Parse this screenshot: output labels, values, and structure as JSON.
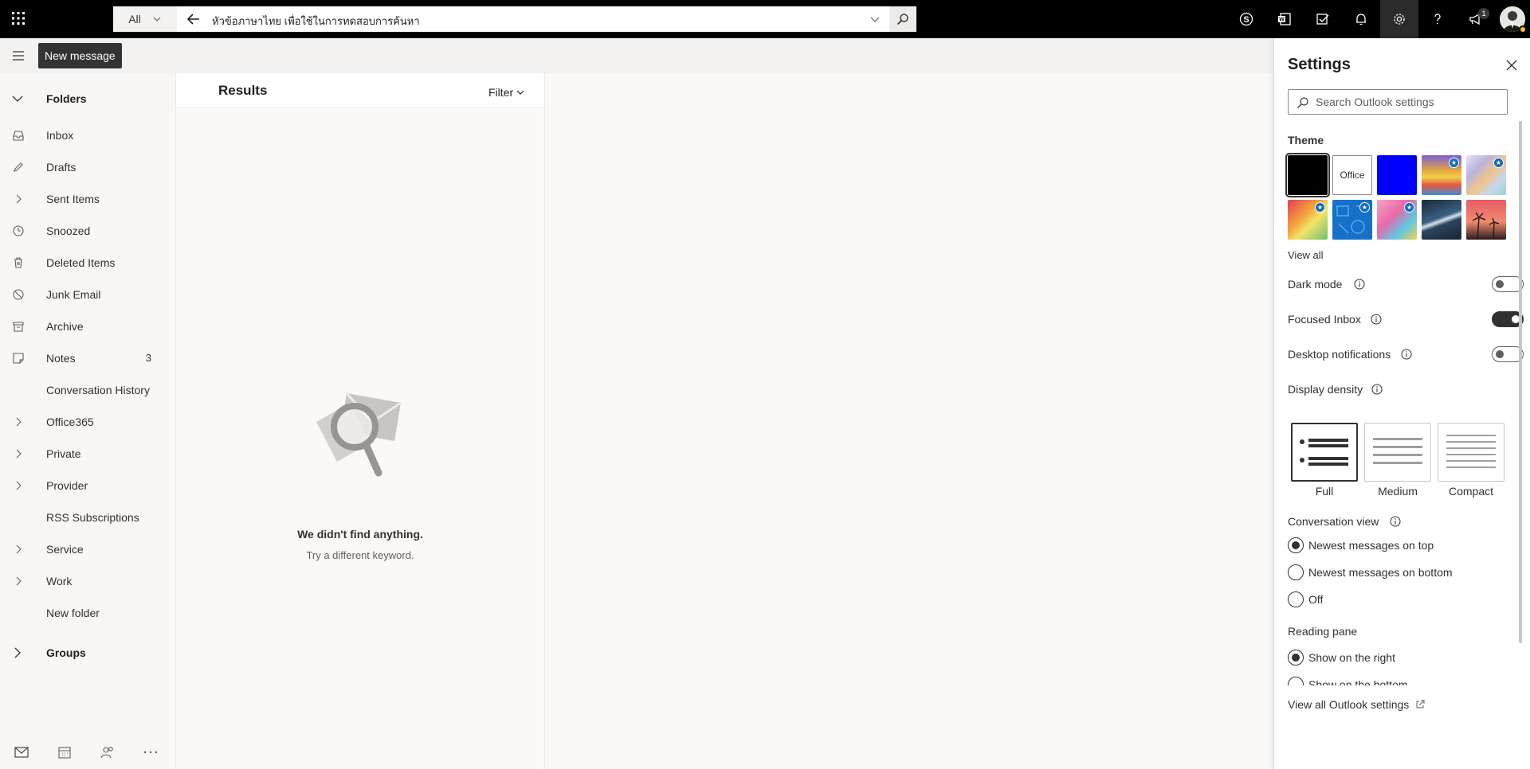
{
  "topbar": {
    "scope": "All",
    "query": "หัวข้อภาษาไทย เพื่อใช้ในการทดสอบการค้นหา",
    "notifications_badge": "1",
    "icons": [
      "app-launcher-icon",
      "skype-icon",
      "office-icon",
      "my-day-icon",
      "bell-icon",
      "gear-icon",
      "help-icon",
      "feedback-icon"
    ]
  },
  "command": {
    "new_message": "New message"
  },
  "nav": {
    "folders_label": "Folders",
    "items": [
      {
        "label": "Inbox",
        "icon": "inbox-icon",
        "count": ""
      },
      {
        "label": "Drafts",
        "icon": "pencil-icon",
        "count": ""
      },
      {
        "label": "Sent Items",
        "icon": "chevron-right-icon",
        "count": ""
      },
      {
        "label": "Snoozed",
        "icon": "clock-icon",
        "count": ""
      },
      {
        "label": "Deleted Items",
        "icon": "trash-icon",
        "count": ""
      },
      {
        "label": "Junk Email",
        "icon": "block-icon",
        "count": ""
      },
      {
        "label": "Archive",
        "icon": "archive-icon",
        "count": ""
      },
      {
        "label": "Notes",
        "icon": "note-icon",
        "count": "3"
      },
      {
        "label": "Conversation History",
        "icon": "",
        "count": ""
      },
      {
        "label": "Office365",
        "icon": "chevron-right-icon",
        "count": ""
      },
      {
        "label": "Private",
        "icon": "chevron-right-icon",
        "count": ""
      },
      {
        "label": "Provider",
        "icon": "chevron-right-icon",
        "count": ""
      },
      {
        "label": "RSS Subscriptions",
        "icon": "",
        "count": ""
      },
      {
        "label": "Service",
        "icon": "chevron-right-icon",
        "count": ""
      },
      {
        "label": "Work",
        "icon": "chevron-right-icon",
        "count": ""
      },
      {
        "label": "New folder",
        "icon": "",
        "count": ""
      }
    ],
    "groups_label": "Groups",
    "bottom_icons": [
      "mail-icon",
      "calendar-icon",
      "people-icon",
      "more-icon"
    ]
  },
  "results": {
    "title": "Results",
    "filter": "Filter",
    "empty_title": "We didn't find anything.",
    "empty_sub": "Try a different keyword."
  },
  "settings": {
    "title": "Settings",
    "search_placeholder": "Search Outlook settings",
    "theme_label": "Theme",
    "office_tile": "Office",
    "view_all": "View all",
    "dark_mode": "Dark mode",
    "dark_mode_on": false,
    "focused_inbox": "Focused Inbox",
    "focused_inbox_on": true,
    "desktop_notifications": "Desktop notifications",
    "desktop_notifications_on": false,
    "display_density": "Display density",
    "density_options": [
      "Full",
      "Medium",
      "Compact"
    ],
    "density_selected": "Full",
    "conversation_view": "Conversation view",
    "conversation_options": [
      "Newest messages on top",
      "Newest messages on bottom",
      "Off"
    ],
    "conversation_selected": "Newest messages on top",
    "reading_pane": "Reading pane",
    "reading_options": [
      "Show on the right",
      "Show on the bottom"
    ],
    "reading_selected": "Show on the right",
    "view_all_settings": "View all Outlook settings"
  }
}
